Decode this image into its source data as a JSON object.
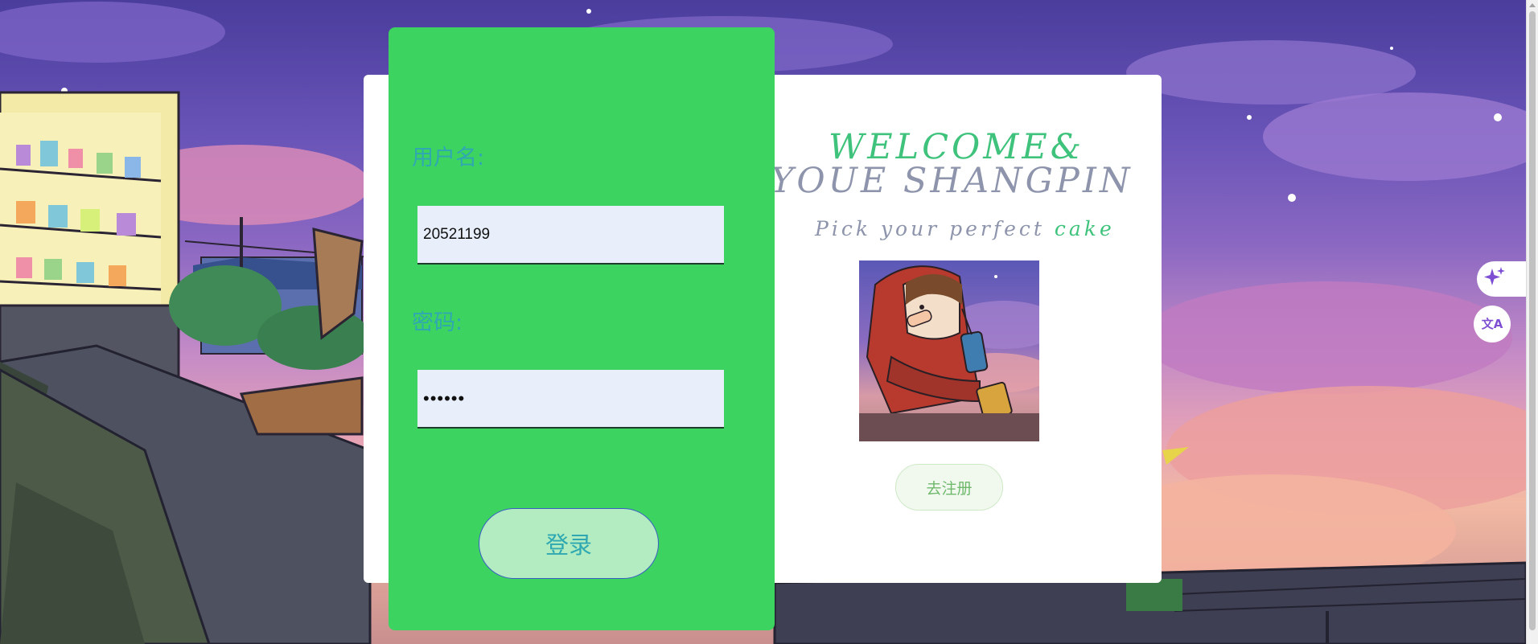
{
  "login": {
    "username_label": "用户名:",
    "username_value": "20521199",
    "password_label": "密码:",
    "password_value": "••••••",
    "login_button": "登录"
  },
  "welcome": {
    "line1": "WELCOME&",
    "line2": "YOUE SHANGPIN",
    "tagline_main": "Pick your perfect ",
    "tagline_accent": "cake",
    "register_button": "去注册"
  },
  "side_tools": {
    "sparkle_icon": "sparkle-icon",
    "translate_icon": "translate-icon",
    "translate_glyph": "文A"
  },
  "colors": {
    "panel_green": "#3dd361",
    "label_teal": "#2fa8b2",
    "welcome_green": "#3fc37c",
    "welcome_gray": "#8d94ab",
    "icon_purple": "#7e4fd3"
  }
}
